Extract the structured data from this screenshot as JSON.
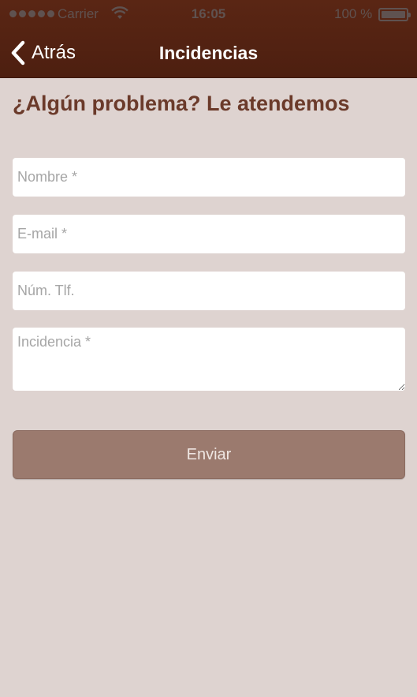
{
  "status_bar": {
    "carrier": "Carrier",
    "time": "16:05",
    "battery_percent": "100 %",
    "wifi_icon": "wifi-icon",
    "battery_icon": "battery-icon"
  },
  "nav": {
    "back_label": "Atrás",
    "back_icon": "chevron-left-icon",
    "title": "Incidencias"
  },
  "form": {
    "heading": "¿Algún problema? Le atendemos",
    "name_placeholder": "Nombre *",
    "email_placeholder": "E-mail *",
    "phone_placeholder": "Núm. Tlf.",
    "incident_placeholder": "Incidencia *",
    "submit_label": "Enviar"
  },
  "colors": {
    "header_bg": "#4d1f10",
    "page_bg": "#ded3d0",
    "heading_text": "#6b3a2a",
    "button_bg": "#9b7a6e"
  }
}
